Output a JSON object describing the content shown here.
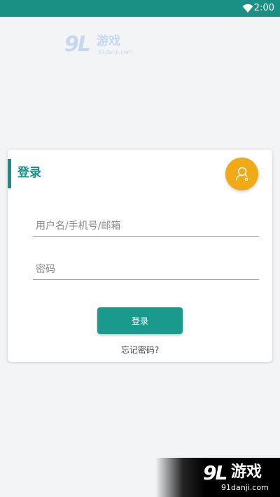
{
  "status_bar": {
    "time": "2:00",
    "icons": [
      "wifi-icon"
    ],
    "color": "#1a8f84"
  },
  "watermark_top": {
    "mark": "9L",
    "name": "游戏",
    "site": "91danji.com"
  },
  "login_card": {
    "title": "登录",
    "accent_color": "#1a8f84",
    "fab_icon": "user-search-icon",
    "fab_color": "#f0a917",
    "username_placeholder": "用户名/手机号/邮箱",
    "username_value": "",
    "password_placeholder": "密码",
    "password_value": "",
    "login_button": "登录",
    "forgot_password": "忘记密码?"
  },
  "watermark_bottom": {
    "mark": "9L",
    "name": "游戏",
    "site": "91danji.com"
  }
}
